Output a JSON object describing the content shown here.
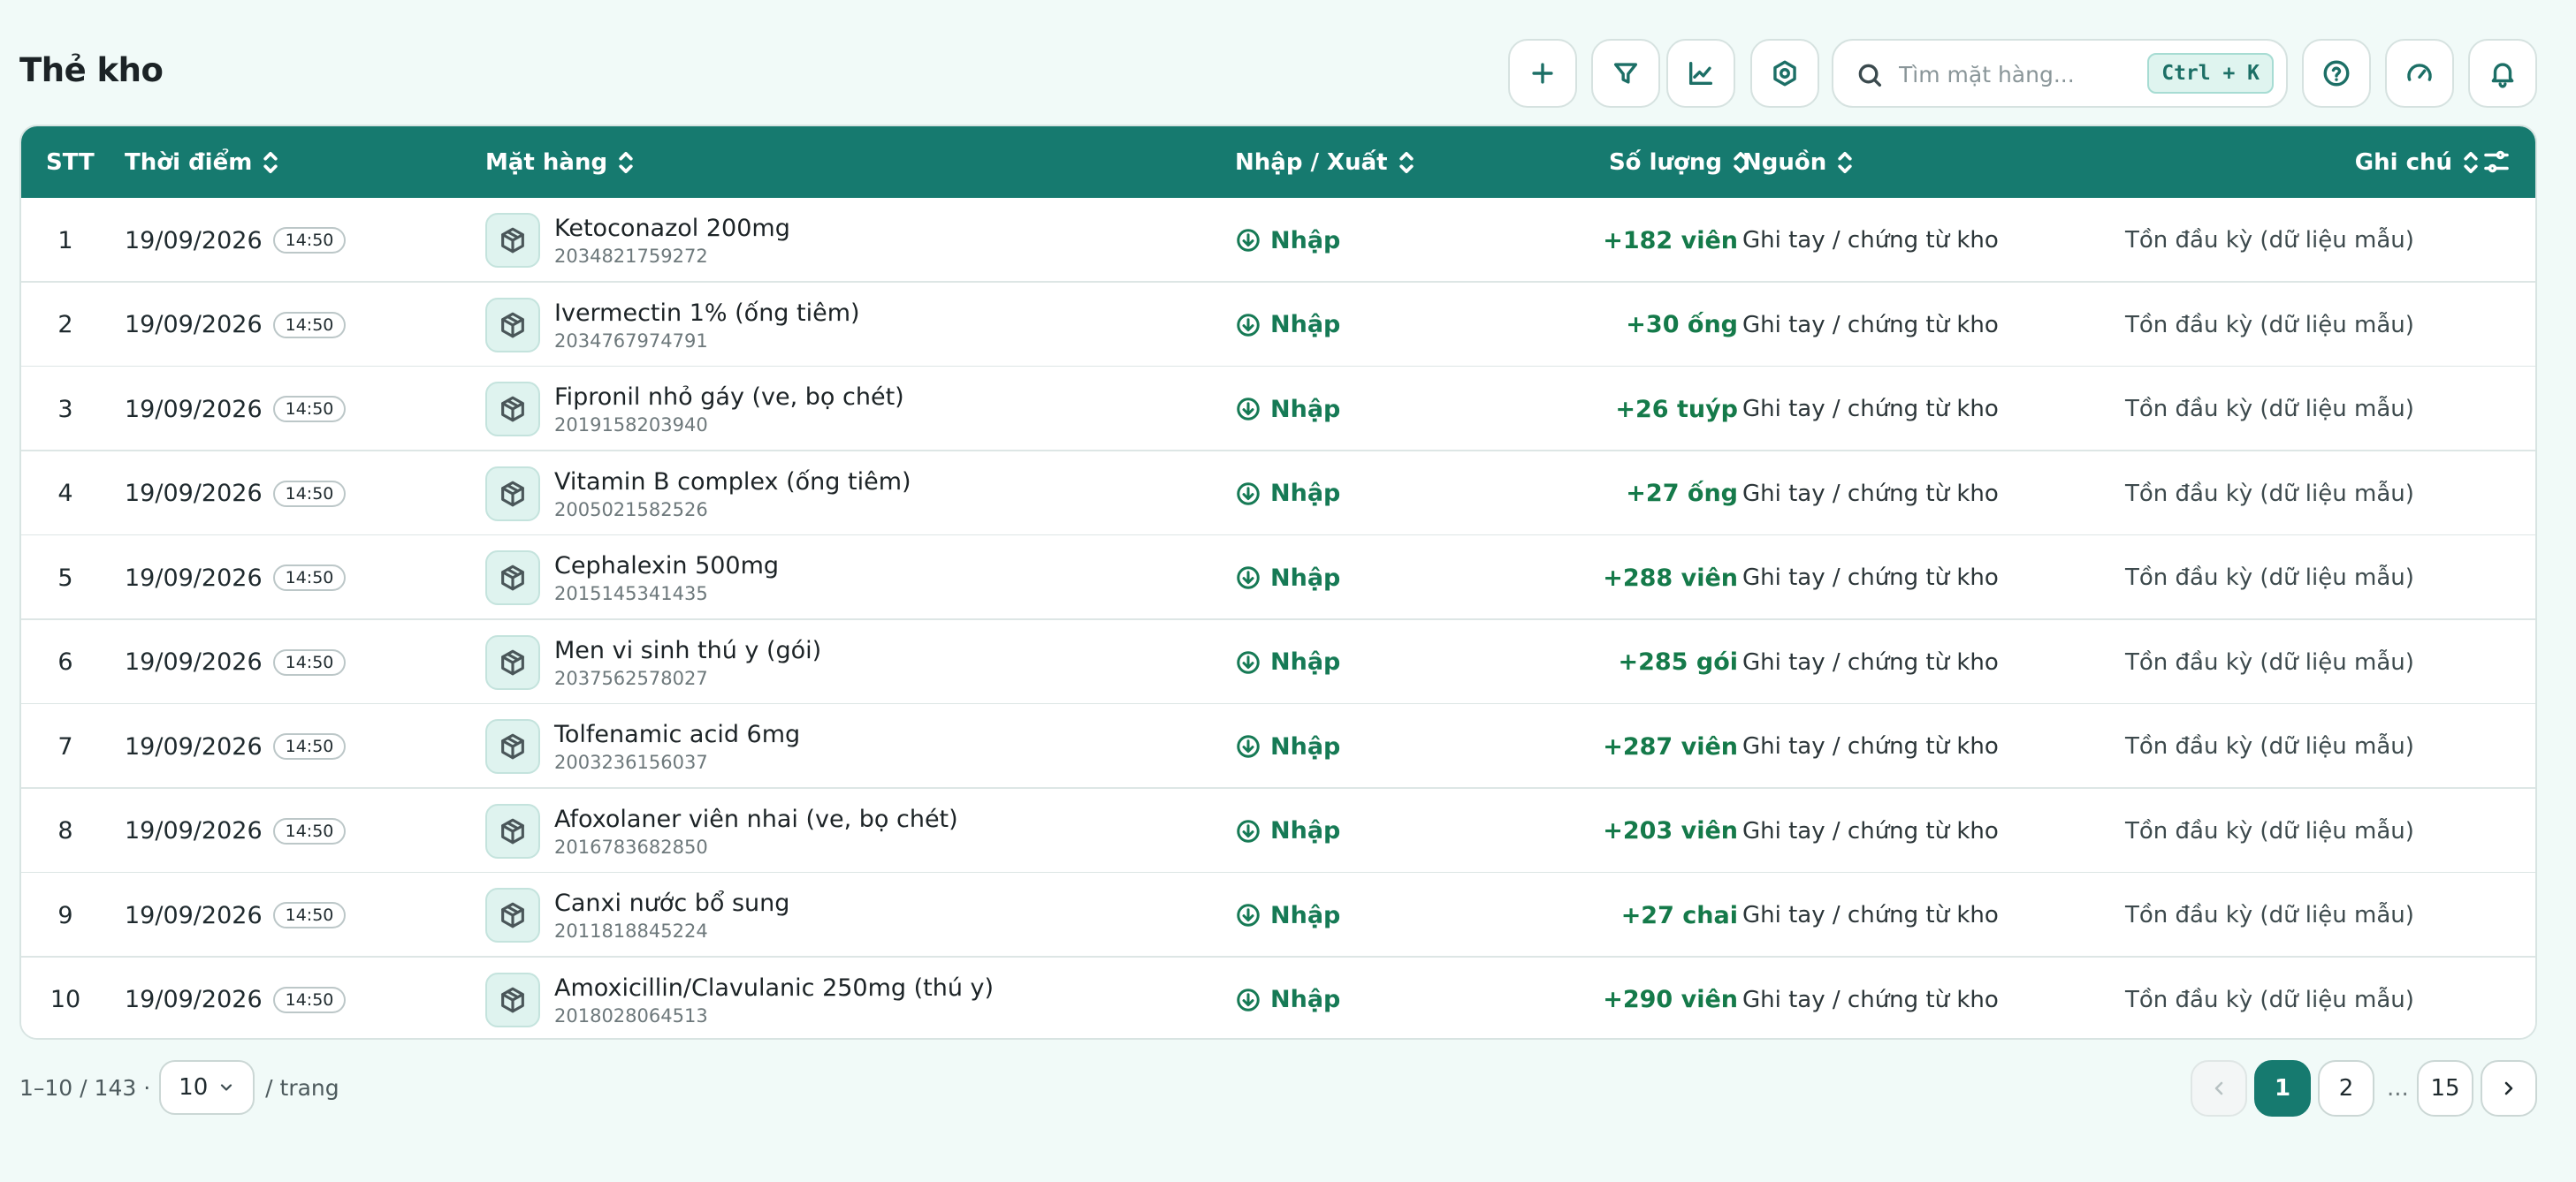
{
  "page": {
    "title": "Thẻ kho"
  },
  "toolbar": {
    "buttons": [
      {
        "name": "add-button",
        "icon": "plus-icon"
      },
      {
        "name": "filter-button",
        "icon": "filter-icon"
      },
      {
        "name": "chart-button",
        "icon": "line-chart-icon"
      },
      {
        "name": "settings-button",
        "icon": "hex-settings-icon"
      }
    ],
    "search": {
      "placeholder": "Tìm mặt hàng...",
      "value": "",
      "shortcut": "Ctrl + K"
    },
    "right_buttons": [
      {
        "name": "help-button",
        "icon": "help-circle-icon"
      },
      {
        "name": "dashboard-button",
        "icon": "gauge-icon"
      },
      {
        "name": "notifications-button",
        "icon": "bell-icon"
      }
    ]
  },
  "table": {
    "columns": {
      "stt": "STT",
      "time": "Thời điểm",
      "item": "Mặt hàng",
      "io": "Nhập / Xuất",
      "qty": "Số lượng",
      "source": "Nguồn",
      "note": "Ghi chú"
    },
    "rows": [
      {
        "stt": "1",
        "date": "19/09/2026",
        "time": "14:50",
        "name": "Ketoconazol 200mg",
        "code": "2034821759272",
        "io": "Nhập",
        "qty": "+182 viên",
        "source": "Ghi tay / chứng từ kho",
        "note": "Tồn đầu kỳ (dữ liệu mẫu)"
      },
      {
        "stt": "2",
        "date": "19/09/2026",
        "time": "14:50",
        "name": "Ivermectin 1% (ống tiêm)",
        "code": "2034767974791",
        "io": "Nhập",
        "qty": "+30 ống",
        "source": "Ghi tay / chứng từ kho",
        "note": "Tồn đầu kỳ (dữ liệu mẫu)"
      },
      {
        "stt": "3",
        "date": "19/09/2026",
        "time": "14:50",
        "name": "Fipronil nhỏ gáy (ve, bọ chét)",
        "code": "2019158203940",
        "io": "Nhập",
        "qty": "+26 tuýp",
        "source": "Ghi tay / chứng từ kho",
        "note": "Tồn đầu kỳ (dữ liệu mẫu)"
      },
      {
        "stt": "4",
        "date": "19/09/2026",
        "time": "14:50",
        "name": "Vitamin B complex (ống tiêm)",
        "code": "2005021582526",
        "io": "Nhập",
        "qty": "+27 ống",
        "source": "Ghi tay / chứng từ kho",
        "note": "Tồn đầu kỳ (dữ liệu mẫu)"
      },
      {
        "stt": "5",
        "date": "19/09/2026",
        "time": "14:50",
        "name": "Cephalexin 500mg",
        "code": "2015145341435",
        "io": "Nhập",
        "qty": "+288 viên",
        "source": "Ghi tay / chứng từ kho",
        "note": "Tồn đầu kỳ (dữ liệu mẫu)"
      },
      {
        "stt": "6",
        "date": "19/09/2026",
        "time": "14:50",
        "name": "Men vi sinh thú y (gói)",
        "code": "2037562578027",
        "io": "Nhập",
        "qty": "+285 gói",
        "source": "Ghi tay / chứng từ kho",
        "note": "Tồn đầu kỳ (dữ liệu mẫu)"
      },
      {
        "stt": "7",
        "date": "19/09/2026",
        "time": "14:50",
        "name": "Tolfenamic acid 6mg",
        "code": "2003236156037",
        "io": "Nhập",
        "qty": "+287 viên",
        "source": "Ghi tay / chứng từ kho",
        "note": "Tồn đầu kỳ (dữ liệu mẫu)"
      },
      {
        "stt": "8",
        "date": "19/09/2026",
        "time": "14:50",
        "name": "Afoxolaner viên nhai (ve, bọ chét)",
        "code": "2016783682850",
        "io": "Nhập",
        "qty": "+203 viên",
        "source": "Ghi tay / chứng từ kho",
        "note": "Tồn đầu kỳ (dữ liệu mẫu)"
      },
      {
        "stt": "9",
        "date": "19/09/2026",
        "time": "14:50",
        "name": "Canxi nước bổ sung",
        "code": "2011818845224",
        "io": "Nhập",
        "qty": "+27 chai",
        "source": "Ghi tay / chứng từ kho",
        "note": "Tồn đầu kỳ (dữ liệu mẫu)"
      },
      {
        "stt": "10",
        "date": "19/09/2026",
        "time": "14:50",
        "name": "Amoxicillin/Clavulanic 250mg (thú y)",
        "code": "2018028064513",
        "io": "Nhập",
        "qty": "+290 viên",
        "source": "Ghi tay / chứng từ kho",
        "note": "Tồn đầu kỳ (dữ liệu mẫu)"
      }
    ]
  },
  "pagination": {
    "range_text": "1–10 / 143 ·",
    "page_size": "10",
    "per_page_label": "/ trang",
    "pages": [
      "1",
      "2"
    ],
    "ellipsis": "...",
    "last_page": "15",
    "current_page": "1"
  },
  "colors": {
    "accent": "#167a6f",
    "background": "#f1faf8",
    "import_green": "#167a55"
  }
}
